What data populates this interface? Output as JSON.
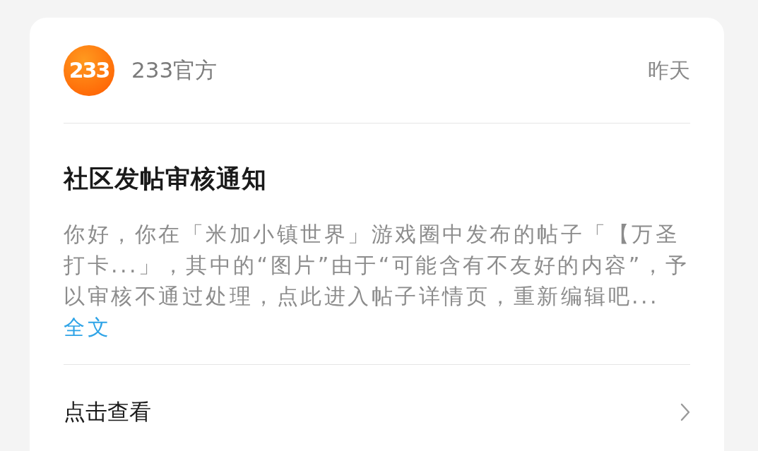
{
  "notification": {
    "logo_text": "233",
    "sender": "233官方",
    "time": "昨天",
    "title": "社区发帖审核通知",
    "body": "你好，你在「米加小镇世界」游戏圈中发布的帖子「【万圣打卡...」，其中的“图片”由于“可能含有不友好的内容”，予以审核不通过处理，点此进入帖子详情页，重新编辑吧...",
    "more_link": "全文",
    "action": "点击查看"
  }
}
